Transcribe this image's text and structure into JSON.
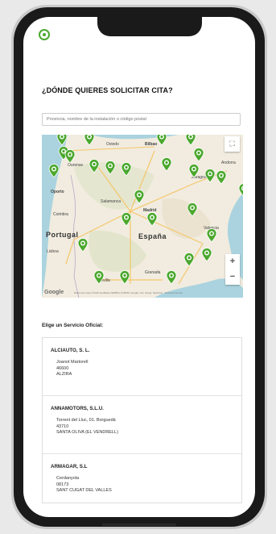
{
  "page": {
    "title": "¿DÓNDE QUIERES SOLICITAR CITA?",
    "search_placeholder": "Provincia, nombre de la instalación o código postal",
    "section_label": "Elige un Servicio Oficial:"
  },
  "map": {
    "big_labels": {
      "portugal": "Portugal",
      "espana": "España"
    },
    "labels": [
      "Oviedo",
      "Bilbao",
      "Ourense",
      "Oporto",
      "Salamanca",
      "Madrid",
      "Zaragoza",
      "Andorra",
      "Coimbra",
      "Lisboa",
      "Valencia",
      "Sevilla",
      "Granada"
    ],
    "attribution": "Datos del mapa ©2019 GeoBasis-DE/BKG (©2009), Google, Inst. Geogr. Nacional · Términos de uso",
    "google_logo": "Google",
    "zoom_in": "+",
    "zoom_out": "−",
    "pin_color": "#4ba82e",
    "pins": 24
  },
  "dealers": [
    {
      "name": "ALCIAUTO, S. L.",
      "address": "Joanot Martorell",
      "postal": "46600",
      "city": "ALZIRA"
    },
    {
      "name": "ANNAMOTORS, S.L.U.",
      "address": "Torrent del Lluc, 01. Borguedà",
      "postal": "43710",
      "city": "SANTA OLIVA (EL VENDRELL)"
    },
    {
      "name": "ARMAGAR, S.L",
      "address": "Cerdanyola",
      "postal": "08173",
      "city": "SANT CUGAT DEL VALLES"
    }
  ],
  "colors": {
    "accent": "#4ba82e",
    "road": "#f5c66a",
    "sea": "#aad3df"
  }
}
